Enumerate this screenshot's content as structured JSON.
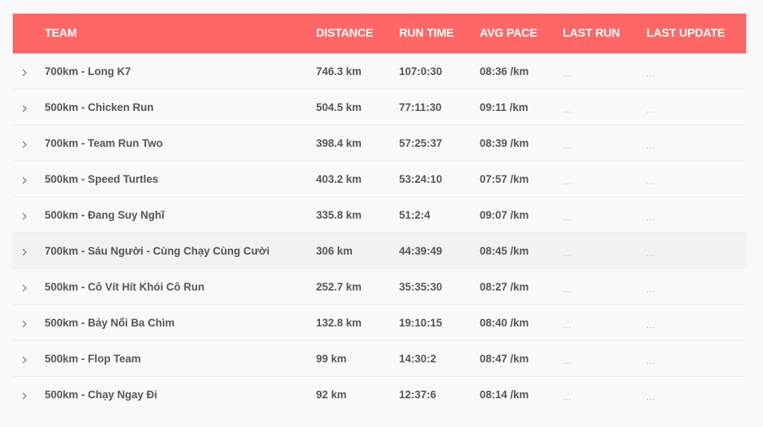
{
  "columns": {
    "team": "TEAM",
    "distance": "DISTANCE",
    "run_time": "RUN TIME",
    "avg_pace": "AVG PACE",
    "last_run": "LAST RUN",
    "last_update": "LAST UPDATE"
  },
  "rows": [
    {
      "team": "700km - Long K7",
      "distance": "746.3 km",
      "run_time": "107:0:30",
      "avg_pace": "08:36 /km",
      "last_run": "...",
      "last_update": "..."
    },
    {
      "team": "500km - Chicken Run",
      "distance": "504.5 km",
      "run_time": "77:11:30",
      "avg_pace": "09:11 /km",
      "last_run": "...",
      "last_update": "..."
    },
    {
      "team": "700km - Team Run Two",
      "distance": "398.4 km",
      "run_time": "57:25:37",
      "avg_pace": "08:39 /km",
      "last_run": "...",
      "last_update": "..."
    },
    {
      "team": "500km - Speed Turtles",
      "distance": "403.2 km",
      "run_time": "53:24:10",
      "avg_pace": "07:57 /km",
      "last_run": "...",
      "last_update": "..."
    },
    {
      "team": "500km - Đang Suy Nghĩ",
      "distance": "335.8 km",
      "run_time": "51:2:4",
      "avg_pace": "09:07 /km",
      "last_run": "...",
      "last_update": "..."
    },
    {
      "team": "700km - Sáu Người - Cùng Chạy Cùng Cười",
      "distance": "306 km",
      "run_time": "44:39:49",
      "avg_pace": "08:45 /km",
      "last_run": "...",
      "last_update": "..."
    },
    {
      "team": "500km - Cô Vít Hít Khói Cô Run",
      "distance": "252.7 km",
      "run_time": "35:35:30",
      "avg_pace": "08:27 /km",
      "last_run": "...",
      "last_update": "..."
    },
    {
      "team": "500km - Bảy Nổi Ba Chìm",
      "distance": "132.8 km",
      "run_time": "19:10:15",
      "avg_pace": "08:40 /km",
      "last_run": "...",
      "last_update": "..."
    },
    {
      "team": "500km - Flop Team",
      "distance": "99 km",
      "run_time": "14:30:2",
      "avg_pace": "08:47 /km",
      "last_run": "...",
      "last_update": "..."
    },
    {
      "team": "500km - Chạy Ngay Đi",
      "distance": "92 km",
      "run_time": "12:37:6",
      "avg_pace": "08:14 /km",
      "last_run": "...",
      "last_update": "..."
    }
  ]
}
